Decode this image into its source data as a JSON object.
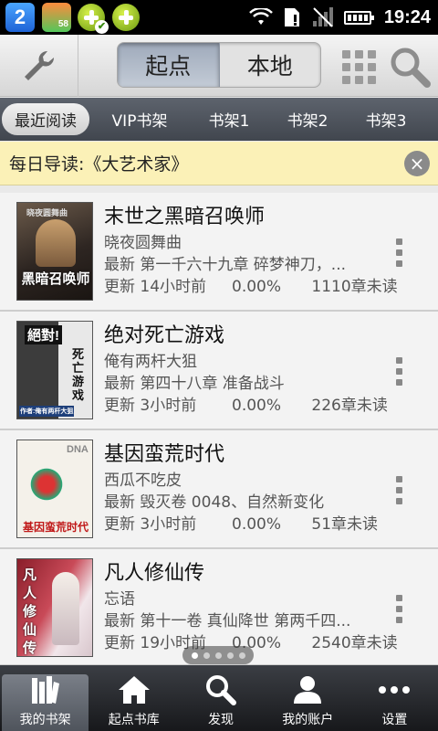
{
  "status_bar": {
    "notifications": [
      {
        "icon": "qq-icon",
        "text": "2"
      },
      {
        "icon": "game-app-icon",
        "text": "58"
      },
      {
        "icon": "plus-check-icon"
      },
      {
        "icon": "plus-icon"
      }
    ],
    "time": "19:24"
  },
  "topbar": {
    "segments": [
      "起点",
      "本地"
    ],
    "active_segment": "起点"
  },
  "tabs": [
    "最近阅读",
    "VIP书架",
    "书架1",
    "书架2",
    "书架3"
  ],
  "notice": {
    "text": "每日导读:《大艺术家》"
  },
  "books": [
    {
      "title": "末世之黑暗召唤师",
      "author": "晓夜圆舞曲",
      "latest": "最新 第一千六十九章 碎梦神刀，...",
      "updated": "更新 14小时前",
      "progress": "0.00%",
      "unread": "1110章未读"
    },
    {
      "title": "绝对死亡游戏",
      "author": "俺有两杆大狙",
      "latest": "最新 第四十八章  准备战斗",
      "updated": "更新 3小时前",
      "progress": "0.00%",
      "unread": "226章未读"
    },
    {
      "title": "基因蛮荒时代",
      "author": "西瓜不吃皮",
      "latest": "最新 毁灭卷  0048、自然新变化",
      "updated": "更新 3小时前",
      "progress": "0.00%",
      "unread": "51章未读"
    },
    {
      "title": "凡人修仙传",
      "author": "忘语",
      "latest": "最新 第十一卷 真仙降世 第两千四...",
      "updated": "更新 19小时前",
      "progress": "0.00%",
      "unread": "2540章未读"
    }
  ],
  "covers": {
    "book1": {
      "top": "晓夜圆舞曲",
      "bottom": "黑暗召唤师"
    },
    "book2": {
      "top": "絕對!",
      "side": "死亡游戏",
      "bottom": "作者:俺有两杆大狙"
    },
    "book3": {
      "top": "DNA",
      "bottom": "基因蛮荒时代"
    },
    "book4": {
      "text": "凡人修仙传"
    }
  },
  "bottom_nav": [
    "我的书架",
    "起点书库",
    "发现",
    "我的账户",
    "设置"
  ],
  "pager": {
    "pages": 5,
    "current": 1
  },
  "colors": {
    "notice_bg": "#fbf1b7",
    "tabs_bg": "#4b5058",
    "nav_bg": "#25272b"
  }
}
